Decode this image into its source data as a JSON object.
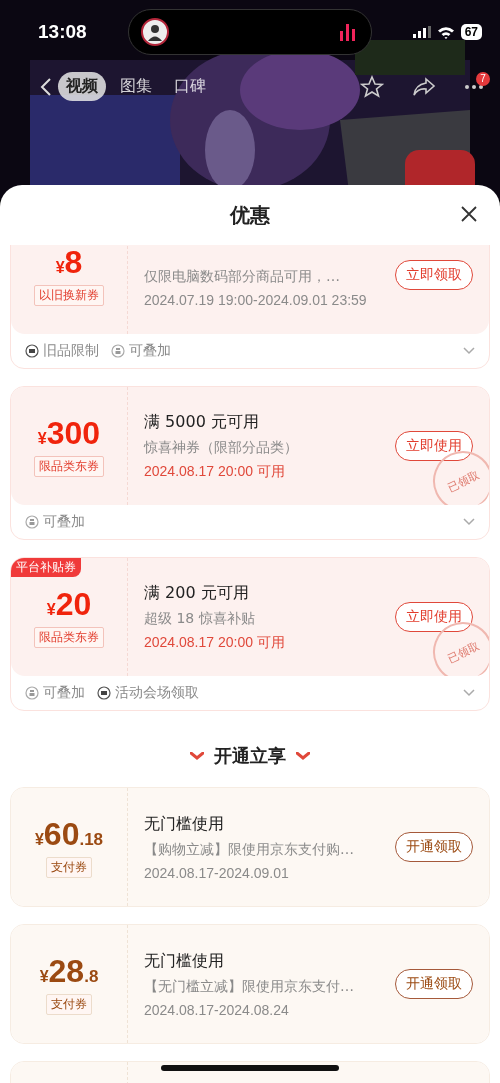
{
  "status_bar": {
    "time": "13:08",
    "battery": "67"
  },
  "nav": {
    "tabs": [
      {
        "label": "视频",
        "selected": true
      },
      {
        "label": "图集",
        "selected": false
      },
      {
        "label": "口碑",
        "selected": false
      }
    ],
    "more_badge": "7"
  },
  "panel": {
    "title": "优惠"
  },
  "coupons": [
    {
      "kind": "red",
      "currency": "¥",
      "amount": "8",
      "tag": "以旧换新券",
      "desc": "仅限电脑数码部分商品可用，…",
      "date": "2024.07.19 19:00-2024.09.01 23:59",
      "date_highlight": false,
      "button": "立即领取",
      "footer": [
        {
          "kind": "limit",
          "text": "旧品限制"
        },
        {
          "kind": "stack",
          "text": "可叠加"
        }
      ]
    },
    {
      "kind": "red",
      "currency": "¥",
      "amount": "300",
      "tag": "限品类东券",
      "title": "满 5000 元可用",
      "desc": "惊喜神券（限部分品类）",
      "date": "2024.08.17 20:00 可用",
      "date_highlight": true,
      "button": "立即使用",
      "stamp": "已领取",
      "footer": [
        {
          "kind": "stack",
          "text": "可叠加"
        }
      ]
    },
    {
      "kind": "red",
      "corner": "平台补贴券",
      "currency": "¥",
      "amount": "20",
      "tag": "限品类东券",
      "title": "满 200 元可用",
      "desc": "超级 18 惊喜补贴",
      "date": "2024.08.17 20:00 可用",
      "date_highlight": true,
      "button": "立即使用",
      "stamp": "已领取",
      "footer": [
        {
          "kind": "stack",
          "text": "可叠加"
        },
        {
          "kind": "limit",
          "text": "活动会场领取"
        }
      ]
    },
    {
      "kind": "section",
      "title": "开通立享"
    },
    {
      "kind": "gold",
      "currency": "¥",
      "amount": "60",
      "decimal": ".18",
      "tag": "支付券",
      "title": "无门槛使用",
      "desc": "【购物立减】限使用京东支付购…",
      "date": "2024.08.17-2024.09.01",
      "date_highlight": false,
      "button": "开通领取"
    },
    {
      "kind": "gold",
      "currency": "¥",
      "amount": "28",
      "decimal": ".8",
      "tag": "支付券",
      "title": "无门槛使用",
      "desc": "【无门槛立减】限使用京东支付…",
      "date": "2024.08.17-2024.08.24",
      "date_highlight": false,
      "button": "开通领取"
    },
    {
      "kind": "gold"
    }
  ]
}
